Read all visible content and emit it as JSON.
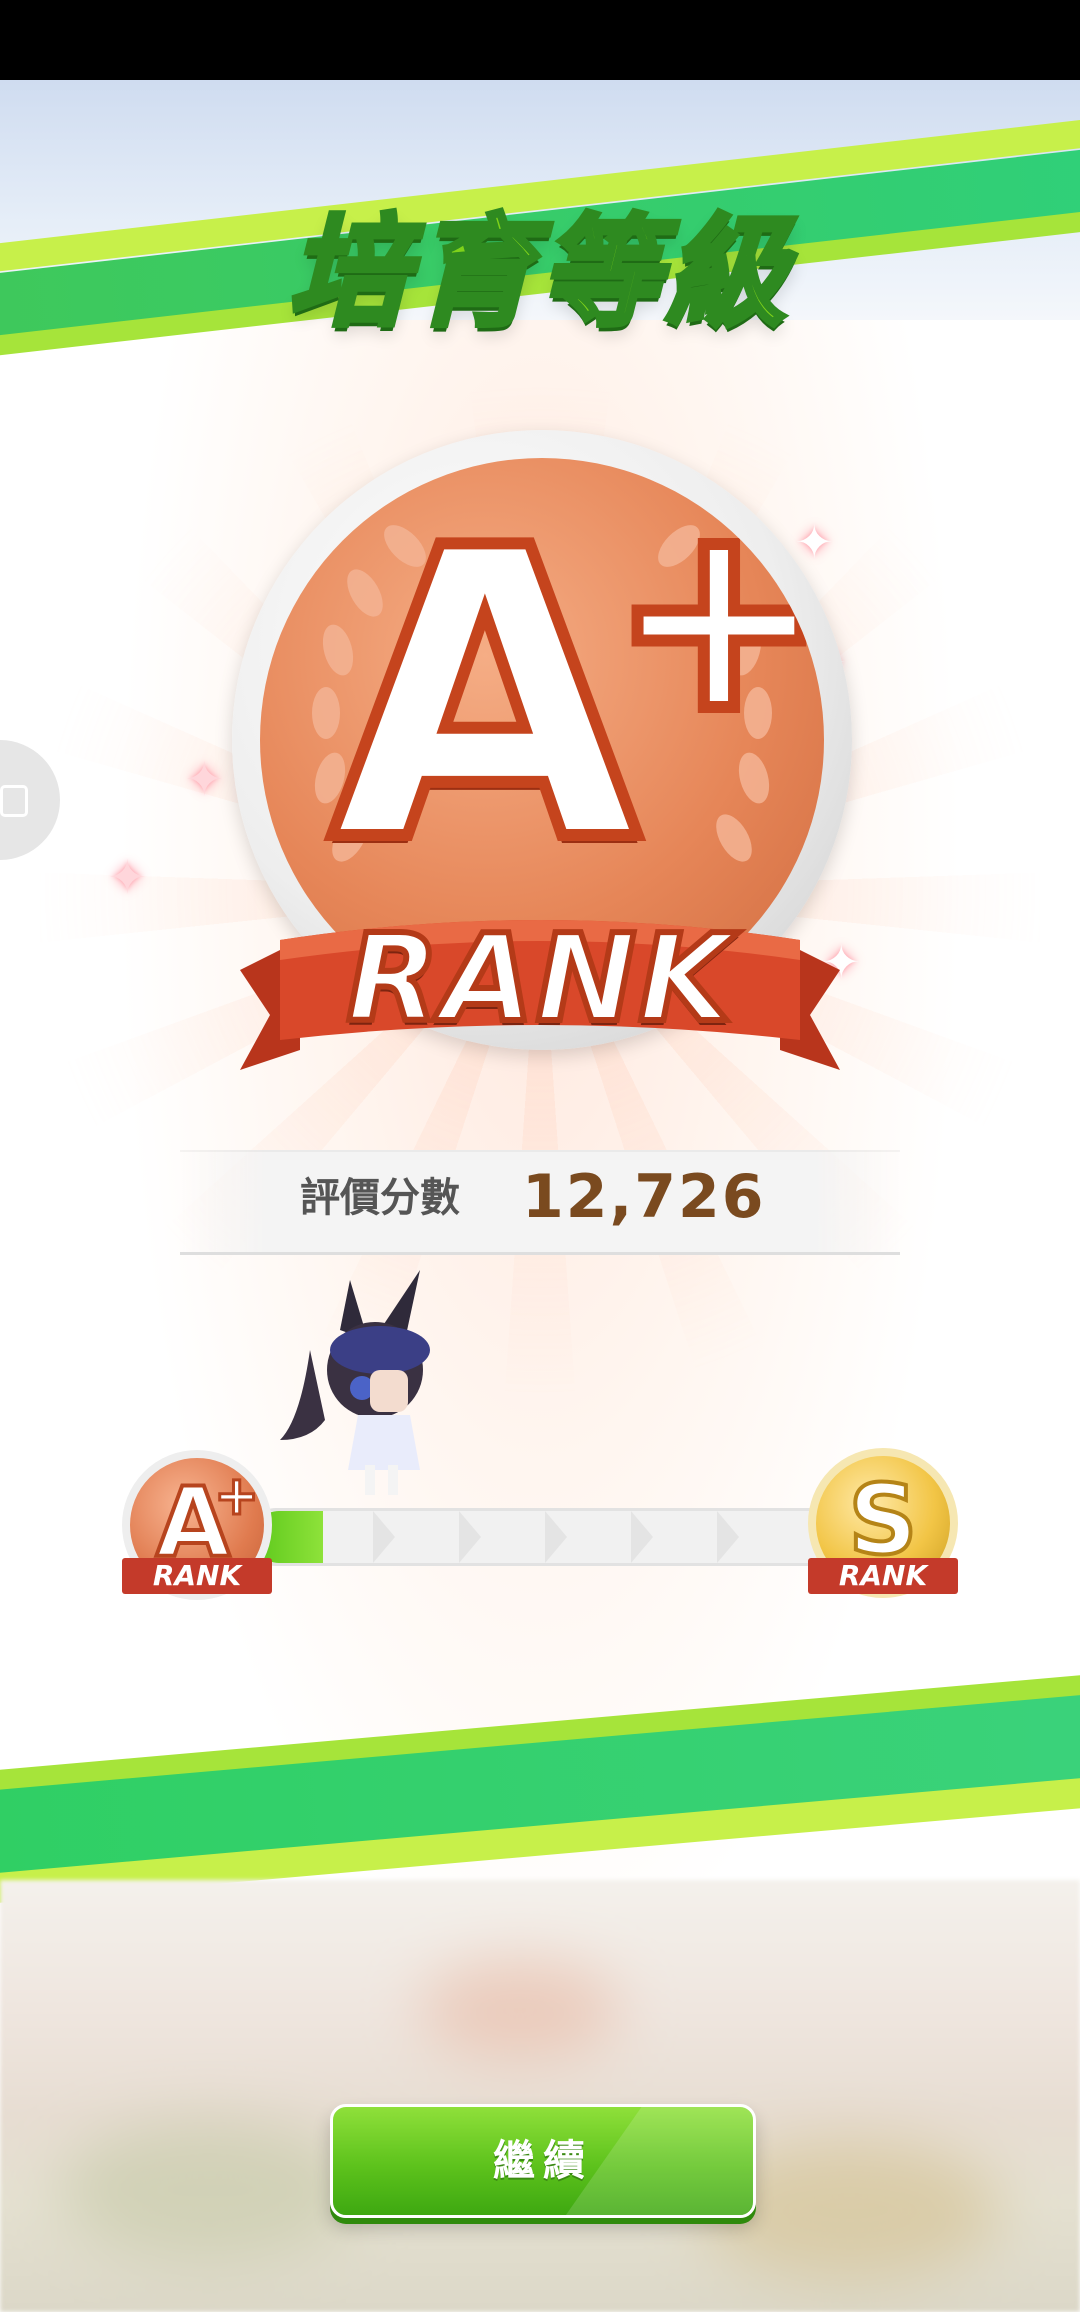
{
  "header": {
    "title": "培育等級"
  },
  "rank": {
    "current_grade": "A",
    "current_modifier": "+",
    "ribbon_label": "RANK"
  },
  "score": {
    "label": "評價分數",
    "value": "12,726"
  },
  "progress": {
    "from_grade": "A",
    "from_modifier": "+",
    "from_ribbon": "RANK",
    "to_grade": "S",
    "to_ribbon": "RANK",
    "fraction": 0.12
  },
  "actions": {
    "continue_label": "繼續"
  },
  "colors": {
    "accent_green": "#5dc21c",
    "medal_copper": "#e68658",
    "medal_gold": "#f2c546",
    "score_text": "#7a4a1f"
  }
}
